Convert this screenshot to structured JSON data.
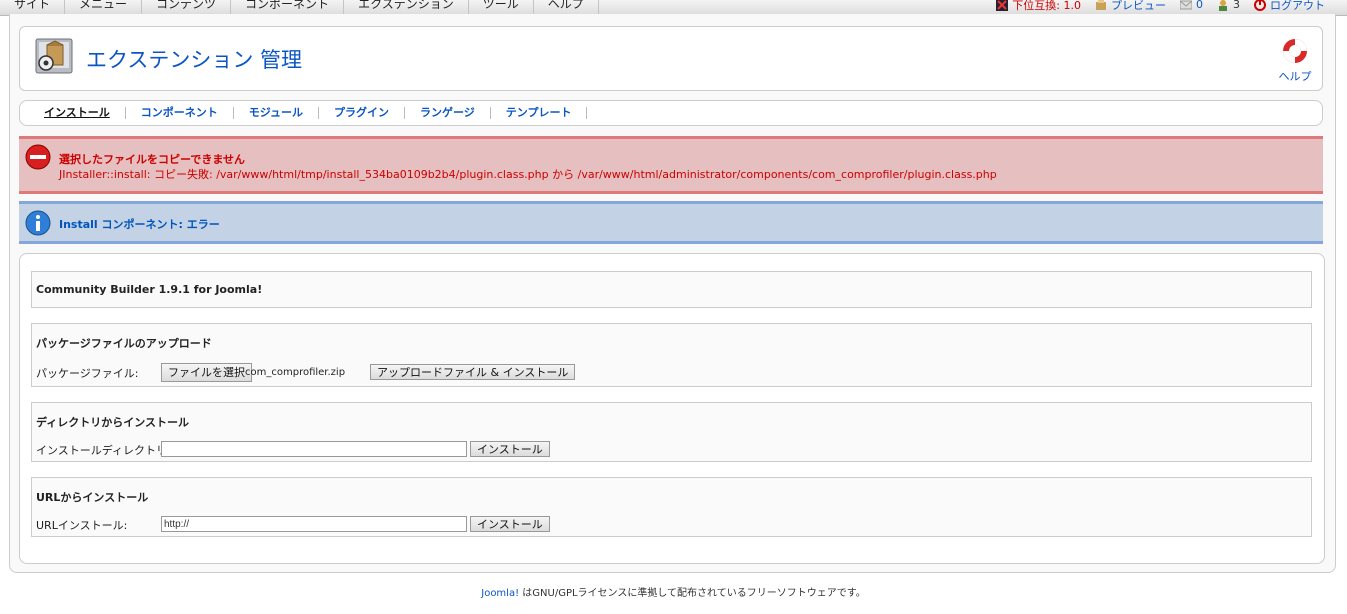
{
  "topmenu": [
    "サイト",
    "メニュー",
    "コンテンツ",
    "コンポーネント",
    "エクステンション",
    "ツール",
    "ヘルプ"
  ],
  "status": {
    "version": "下位互換: 1.0",
    "preview": "プレビュー",
    "messages": "0",
    "users": "3",
    "logout": "ログアウト"
  },
  "header": {
    "title": "エクステンション 管理",
    "help": "ヘルプ"
  },
  "submenu": [
    "インストール",
    "コンポーネント",
    "モジュール",
    "プラグイン",
    "ランゲージ",
    "テンプレート"
  ],
  "error": {
    "line1": "選択したファイルをコピーできません",
    "line2": "JInstaller::install: コピー失敗: /var/www/html/tmp/install_534ba0109b2b4/plugin.class.php から /var/www/html/administrator/components/com_comprofiler/plugin.class.php"
  },
  "info": {
    "text": "Install コンポーネント: エラー"
  },
  "component_title": "Community Builder 1.9.1 for Joomla!",
  "upload": {
    "title": "パッケージファイルのアップロード",
    "label": "パッケージファイル:",
    "choose_button": "ファイルを選択",
    "filename": "com_comprofiler.zip",
    "submit_button": "アップロードファイル & インストール"
  },
  "directory": {
    "title": "ディレクトリからインストール",
    "label": "インストールディレクトリ:",
    "value": "",
    "submit_button": "インストール"
  },
  "url": {
    "title": "URLからインストール",
    "label": "URLインストール:",
    "value": "http://",
    "submit_button": "インストール"
  },
  "footer": {
    "link": "Joomla!",
    "text": " はGNU/GPLライセンスに準拠して配布されているフリーソフトウェアです。"
  },
  "colors": {
    "link": "#0b55c4",
    "error": "#cc0000",
    "error_bg": "#e6c0c0",
    "info_bg": "#c3d2e5"
  }
}
